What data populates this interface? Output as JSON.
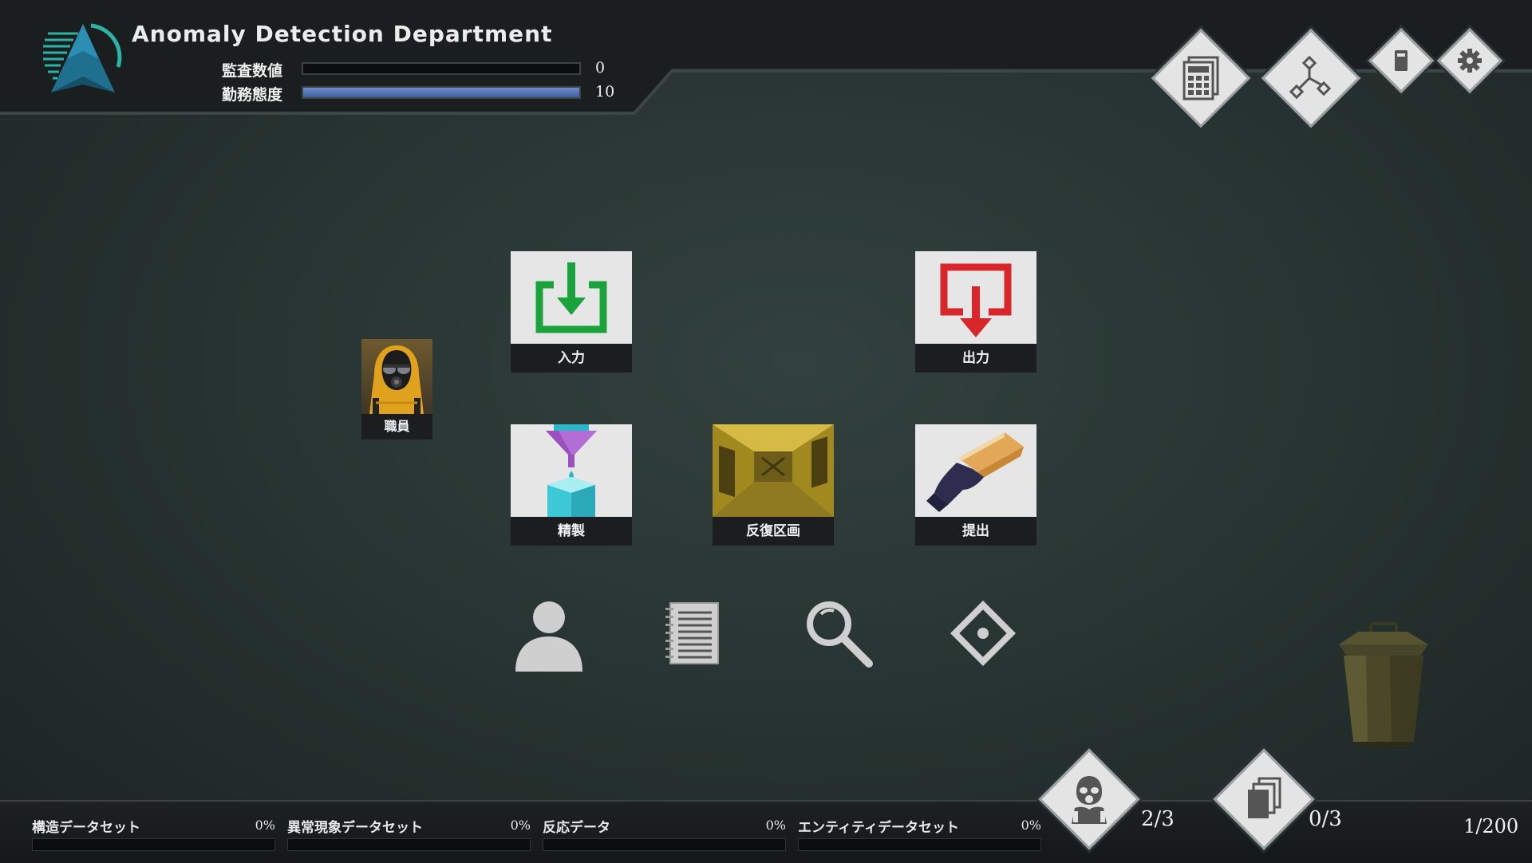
{
  "header": {
    "title": "Anomaly Detection Department",
    "stats": [
      {
        "label": "監査数値",
        "value": "0",
        "fill_fraction": 0.0
      },
      {
        "label": "勤務態度",
        "value": "10",
        "fill_fraction": 1.0
      }
    ]
  },
  "top_buttons": [
    {
      "name": "calculator-icon"
    },
    {
      "name": "flowchart-icon"
    },
    {
      "name": "phone-icon"
    },
    {
      "name": "gear-icon"
    }
  ],
  "tiles": {
    "input_label": "入力",
    "output_label": "出力",
    "refine_label": "精製",
    "loop_label": "反復区画",
    "submit_label": "提出",
    "worker_label": "職員"
  },
  "tools": [
    "person-icon",
    "notebook-icon",
    "magnifier-icon",
    "diamond-target-icon"
  ],
  "bottom": {
    "datasets": [
      {
        "name": "構造データセット",
        "percent": "0%",
        "fill_fraction": 0.0
      },
      {
        "name": "異常現象データセット",
        "percent": "0%",
        "fill_fraction": 0.0
      },
      {
        "name": "反応データ",
        "percent": "0%",
        "fill_fraction": 0.0
      },
      {
        "name": "エンティティデータセット",
        "percent": "0%",
        "fill_fraction": 0.0
      }
    ],
    "staff_count": "2/3",
    "card_count": "0/3",
    "page_counter": "1/200"
  },
  "colors": {
    "background": "#2b3835",
    "accent_blue": "#4f6fae",
    "input_green": "#19a33a",
    "output_red": "#d8262a",
    "tile_bg": "#e6e6e6",
    "label_bg": "#1b1d1f",
    "logo_teal": "#2bb3a6"
  }
}
